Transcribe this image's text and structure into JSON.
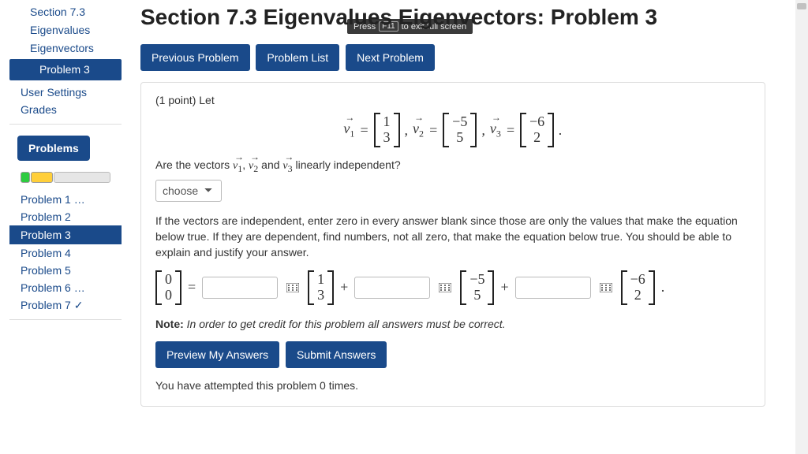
{
  "nav": {
    "section_line1": "Section 7.3",
    "section_line2": "Eigenvalues",
    "section_line3": "Eigenvectors",
    "current_problem": "Problem 3",
    "user_settings": "User Settings",
    "grades": "Grades",
    "problems_header": "Problems",
    "items": [
      {
        "label": "Problem 1 …"
      },
      {
        "label": "Problem 2"
      },
      {
        "label": "Problem 3"
      },
      {
        "label": "Problem 4"
      },
      {
        "label": "Problem 5"
      },
      {
        "label": "Problem 6 …"
      },
      {
        "label": "Problem 7 ✓"
      }
    ]
  },
  "overlay": {
    "press": "Press",
    "key": "F11",
    "rest": "to exit full screen"
  },
  "header": {
    "title": "Section 7.3 Eigenvalues Eigenvectors: Problem 3"
  },
  "navbtns": {
    "prev": "Previous Problem",
    "list": "Problem List",
    "next": "Next Problem"
  },
  "problem": {
    "points": "(1 point) Let",
    "v1": {
      "top": "1",
      "bot": "3"
    },
    "v2": {
      "top": "−5",
      "bot": "5"
    },
    "v3": {
      "top": "−6",
      "bot": "2"
    },
    "question": "Are the vectors",
    "question_tail": "linearly independent?",
    "and": "and",
    "choose_placeholder": "choose",
    "para": "If the vectors are independent, enter zero in every answer blank since those are only the values that make the equation below true. If they are dependent, find numbers, not all zero, that make the equation below true. You should be able to explain and justify your answer.",
    "zero": {
      "top": "0",
      "bot": "0"
    },
    "eq": "=",
    "plus": "+",
    "period": ".",
    "comma": ",",
    "note_label": "Note:",
    "note_text": "In order to get credit for this problem all answers must be correct.",
    "preview": "Preview My Answers",
    "submit": "Submit Answers",
    "attempts": "You have attempted this problem 0 times."
  },
  "vecnames": {
    "v1": "v",
    "v2": "v",
    "v3": "v",
    "s1": "1",
    "s2": "2",
    "s3": "3"
  }
}
